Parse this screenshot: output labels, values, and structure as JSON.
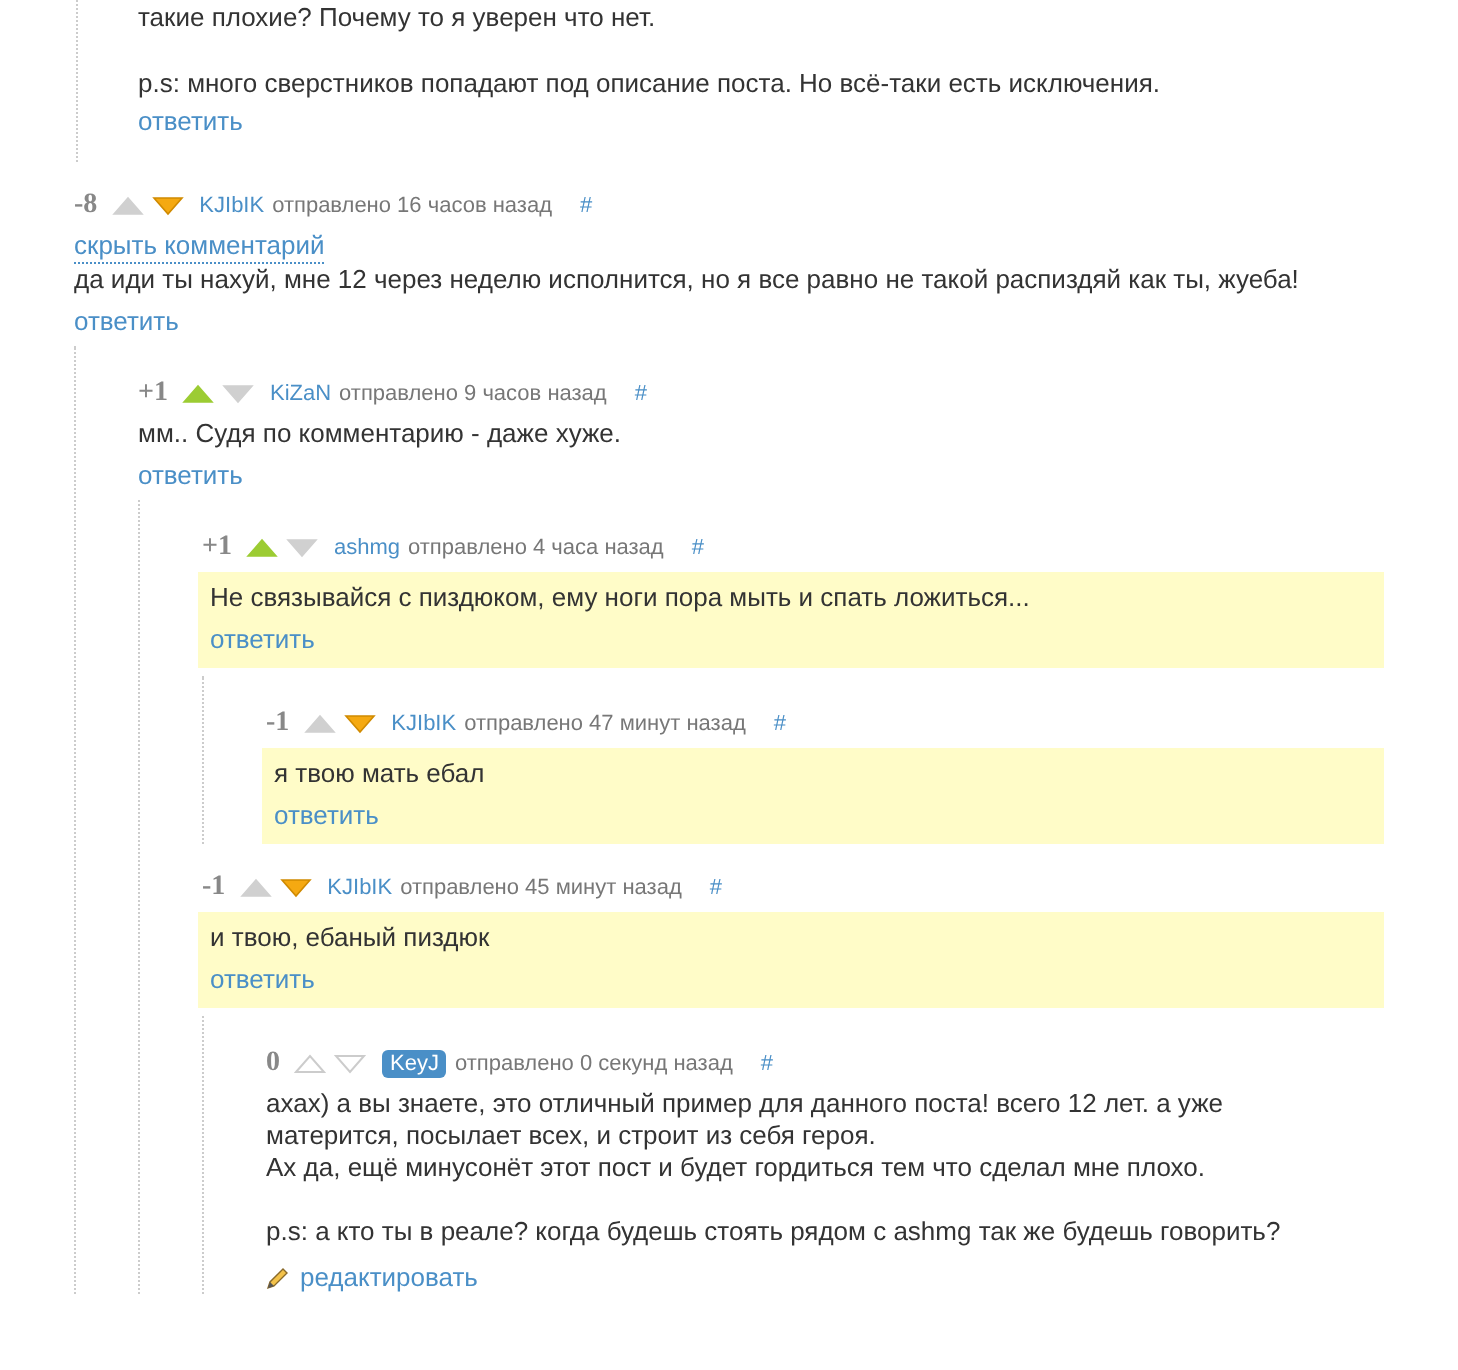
{
  "top_comment": {
    "paragraphs": [
      "такие плохие? Почему то я уверен что нет.",
      "p.s: много сверстников попадают под описание поста. Но всё-таки есть исключения."
    ],
    "action": "ответить"
  },
  "comments": [
    {
      "score": "-8",
      "upvoted": false,
      "downvoted": true,
      "own": false,
      "author": "KJIbIK",
      "sent": "отправлено 16 часов назад",
      "hash": "#",
      "hide_link": "скрыть комментарий",
      "highlighted": false,
      "text": "да иди ты нахуй, мне 12 через неделю исполнится, но я все равно не такой распиздяй как ты, жуеба!",
      "action": {
        "kind": "reply",
        "label": "ответить"
      },
      "children": [
        {
          "score": "+1",
          "upvoted": true,
          "downvoted": false,
          "own": false,
          "author": "KiZaN",
          "sent": "отправлено 9 часов назад",
          "hash": "#",
          "highlighted": false,
          "text": "мм.. Судя по комментарию - даже хуже.",
          "action": {
            "kind": "reply",
            "label": "ответить"
          },
          "children": [
            {
              "score": "+1",
              "upvoted": true,
              "downvoted": false,
              "own": false,
              "author": "ashmg",
              "sent": "отправлено 4 часа назад",
              "hash": "#",
              "highlighted": true,
              "text": "Не связывайся с пиздюком, ему ноги пора мыть и спать ложиться...",
              "action": {
                "kind": "reply",
                "label": "ответить"
              },
              "children": [
                {
                  "score": "-1",
                  "upvoted": false,
                  "downvoted": true,
                  "own": false,
                  "author": "KJIbIK",
                  "sent": "отправлено 47 минут назад",
                  "hash": "#",
                  "highlighted": true,
                  "text": "я твою мать ебал",
                  "action": {
                    "kind": "reply",
                    "label": "ответить"
                  }
                }
              ]
            },
            {
              "score": "-1",
              "upvoted": false,
              "downvoted": true,
              "own": false,
              "author": "KJIbIK",
              "sent": "отправлено 45 минут назад",
              "hash": "#",
              "highlighted": true,
              "text": "и твою, ебаный пиздюк",
              "action": {
                "kind": "reply",
                "label": "ответить"
              },
              "children": [
                {
                  "score": "0",
                  "upvoted": false,
                  "downvoted": false,
                  "own": true,
                  "author": "KeyJ",
                  "sent": "отправлено 0 секунд назад",
                  "hash": "#",
                  "highlighted": false,
                  "text": "ахах) а вы знаете, это отличный пример для данного поста! всего 12 лет. а уже\nматерится, посылает всех, и строит из себя героя.\nАх да, ещё минусонёт этот пост и будет гордиться тем что сделал мне плохо.\n\np.s: а кто ты в реале? когда будешь стоять рядом с ashmg так же будешь говорить?",
                  "action": {
                    "kind": "edit",
                    "label": "редактировать"
                  }
                }
              ]
            }
          ]
        }
      ]
    }
  ]
}
